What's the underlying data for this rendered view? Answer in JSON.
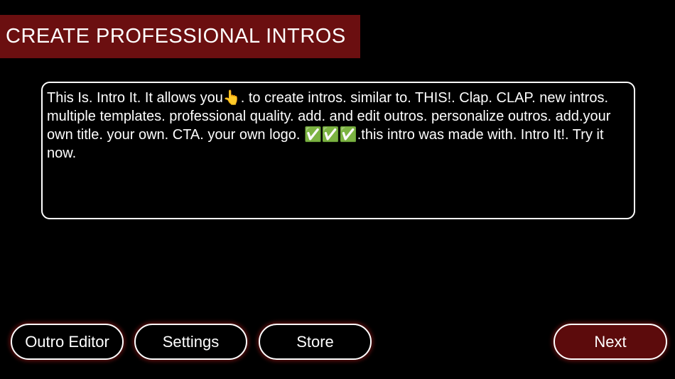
{
  "header": {
    "title": "CREATE PROFESSIONAL INTROS",
    "background_color": "#6b0f10"
  },
  "script_editor": {
    "text": "This Is. Intro It. It allows you👆. to create intros. similar to. THIS!. Clap. CLAP. new intros. multiple templates. professional quality. add. and edit outros. personalize outros. add.your own title. your own. CTA. your own logo. ✅✅✅.this intro was made with. Intro It!. Try it now."
  },
  "buttons": {
    "outro_editor": "Outro Editor",
    "settings": "Settings",
    "store": "Store",
    "next": "Next"
  },
  "colors": {
    "background": "#000000",
    "accent": "#6b0f10",
    "next_button": "#5c0b0c",
    "glow": "#aa1e1e"
  }
}
